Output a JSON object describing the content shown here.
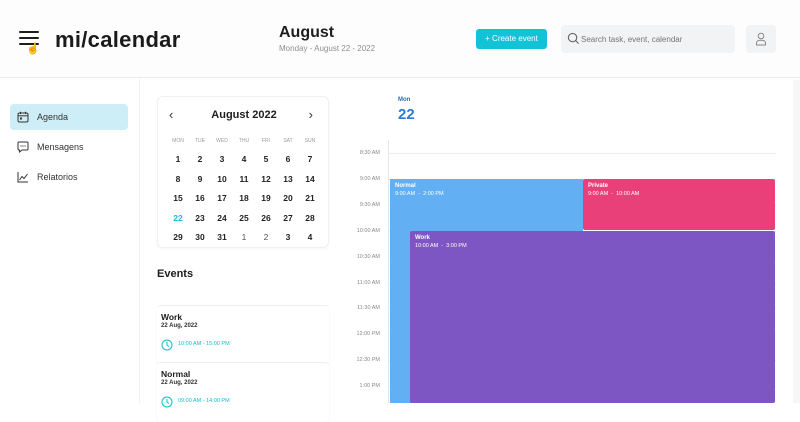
{
  "header": {
    "logo": "mi/calendar",
    "month": "August",
    "subtitle": "Monday - August 22 - 2022",
    "create_button": "+ Create event",
    "search_placeholder": "Search task, event, calendar"
  },
  "sidebar": {
    "items": [
      {
        "label": "Agenda",
        "icon": "calendar-icon",
        "active": true
      },
      {
        "label": "Mensagens",
        "icon": "chat-icon",
        "active": false
      },
      {
        "label": "Relatorios",
        "icon": "chart-line-icon",
        "active": false
      }
    ]
  },
  "mini_calendar": {
    "title": "August 2022",
    "prev": "‹",
    "next": "›",
    "weekdays": [
      "MON",
      "TUE",
      "WED",
      "THU",
      "FRI",
      "SAT",
      "SUN"
    ],
    "weeks": [
      [
        "1",
        "2",
        "3",
        "4",
        "5",
        "6",
        "7"
      ],
      [
        "8",
        "9",
        "10",
        "11",
        "12",
        "13",
        "14"
      ],
      [
        "15",
        "16",
        "17",
        "18",
        "19",
        "20",
        "21"
      ],
      [
        "22",
        "23",
        "24",
        "25",
        "26",
        "27",
        "28"
      ],
      [
        "29",
        "30",
        "31",
        "1",
        "2",
        "3",
        "4"
      ]
    ],
    "today": "22",
    "accent_color": "#12bcd0"
  },
  "events_section": {
    "title": "Events",
    "items": [
      {
        "title": "Work",
        "date": "22 Aug, 2022",
        "time": "10:00 AM - 15:00 PM"
      },
      {
        "title": "Normal",
        "date": "22 Aug, 2022",
        "time": "09:00 AM - 14:00 PM"
      }
    ]
  },
  "day_view": {
    "day_of_week": "Mon",
    "day_number": "22",
    "time_labels": [
      "8:30 AM",
      "9:00 AM",
      "9:30 AM",
      "10:00 AM",
      "10:30 AM",
      "11:00 AM",
      "11:30 AM",
      "12:00 PM",
      "12:30 PM",
      "1:00 PM"
    ],
    "events": {
      "normal": {
        "title": "Normal",
        "time": "9:00 AM  -  2:00 PM",
        "color": "#62b0f3"
      },
      "private": {
        "title": "Private",
        "time": "9:00 AM  -  10:00 AM",
        "color": "#e9407a"
      },
      "work": {
        "title": "Work",
        "time": "10:00 AM  -  3:00 PM",
        "color": "#7e56c3"
      }
    }
  }
}
